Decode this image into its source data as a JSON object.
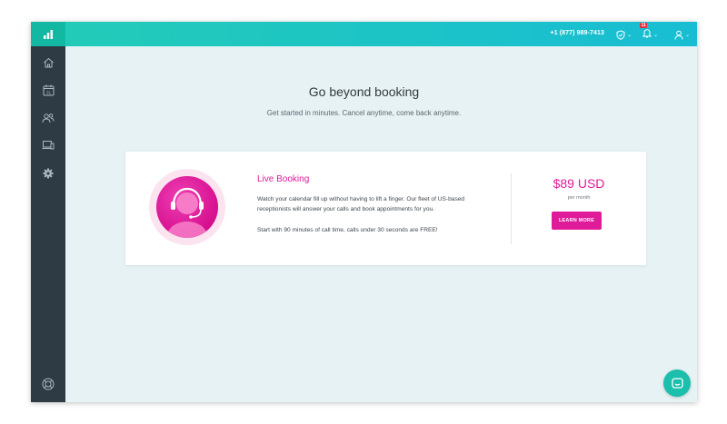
{
  "topbar": {
    "phone": "+1 (877) 989-7413",
    "notifications_badge": "11"
  },
  "sidebar": {
    "items": [
      {
        "icon": "home-icon"
      },
      {
        "icon": "calendar-icon",
        "label": "31"
      },
      {
        "icon": "users-icon"
      },
      {
        "icon": "devices-icon"
      },
      {
        "icon": "gear-icon"
      }
    ],
    "bottom_icon": "lifebuoy-icon"
  },
  "main": {
    "title": "Go beyond booking",
    "subtitle": "Get started in minutes. Cancel anytime, come back anytime."
  },
  "card": {
    "title": "Live Booking",
    "description": "Watch your calendar fill up without having to lift a finger. Our fleet of US-based receptionists will answer your calls and book appointments for you.",
    "note": "Start with 90 minutes of call time, calls under 30 seconds are FREE!",
    "price": "$89 USD",
    "price_period": "per month",
    "cta_label": "LEARN MORE"
  },
  "colors": {
    "accent": "#e01b9a",
    "teal": "#1bbfac",
    "sidebar": "#2e3a44",
    "background": "#e6f2f3"
  }
}
